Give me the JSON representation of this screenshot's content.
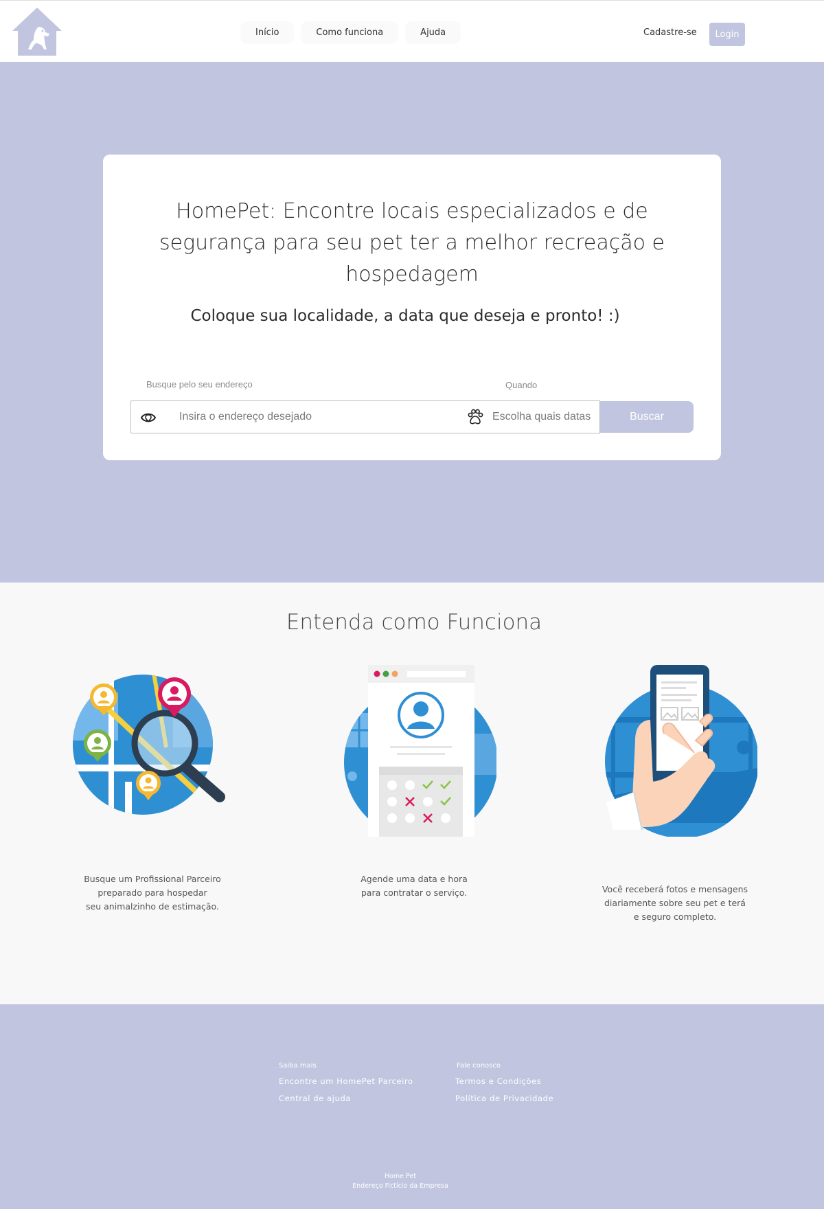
{
  "header": {
    "nav": [
      "Início",
      "Como funciona",
      "Ajuda"
    ],
    "signup": "Cadastre-se",
    "login": "Login"
  },
  "hero": {
    "title": "HomePet: Encontre locais especializados e de segurança para seu pet ter a melhor recreação e hospedagem",
    "subtitle": "Coloque sua localidade, a data que deseja e pronto! :)",
    "address_label": "Busque pelo seu endereço",
    "address_placeholder": "Insira o endereço desejado",
    "when_label": "Quando",
    "date_placeholder": "Escolha quais datas",
    "search_button": "Buscar"
  },
  "how": {
    "title": "Entenda como Funciona",
    "steps": [
      {
        "icon": "map-search-icon",
        "lines": [
          "Busque um Profissional Parceiro",
          "preparado para hospedar",
          "seu animalzinho de estimação."
        ]
      },
      {
        "icon": "calendar-profile-icon",
        "lines": [
          "Agende uma data e hora",
          "para contratar o serviço."
        ]
      },
      {
        "icon": "phone-hand-icon",
        "lines": [
          "Você receberá fotos e mensagens",
          "diariamente sobre seu pet e terá",
          "e seguro completo."
        ]
      }
    ]
  },
  "footer": {
    "col1": {
      "heading": "Saiba mais",
      "links": [
        "Encontre um HomePet Parceiro",
        "Central de ajuda"
      ]
    },
    "col2": {
      "heading": "Fale conosco",
      "links": [
        "Termos e Condições",
        "Política de Privacidade"
      ]
    },
    "brand": "Home Pet",
    "address": "Endereço Fictício da Empresa"
  },
  "colors": {
    "accent": "#c1c5e0",
    "illustration_blue": "#2f8fd3"
  }
}
